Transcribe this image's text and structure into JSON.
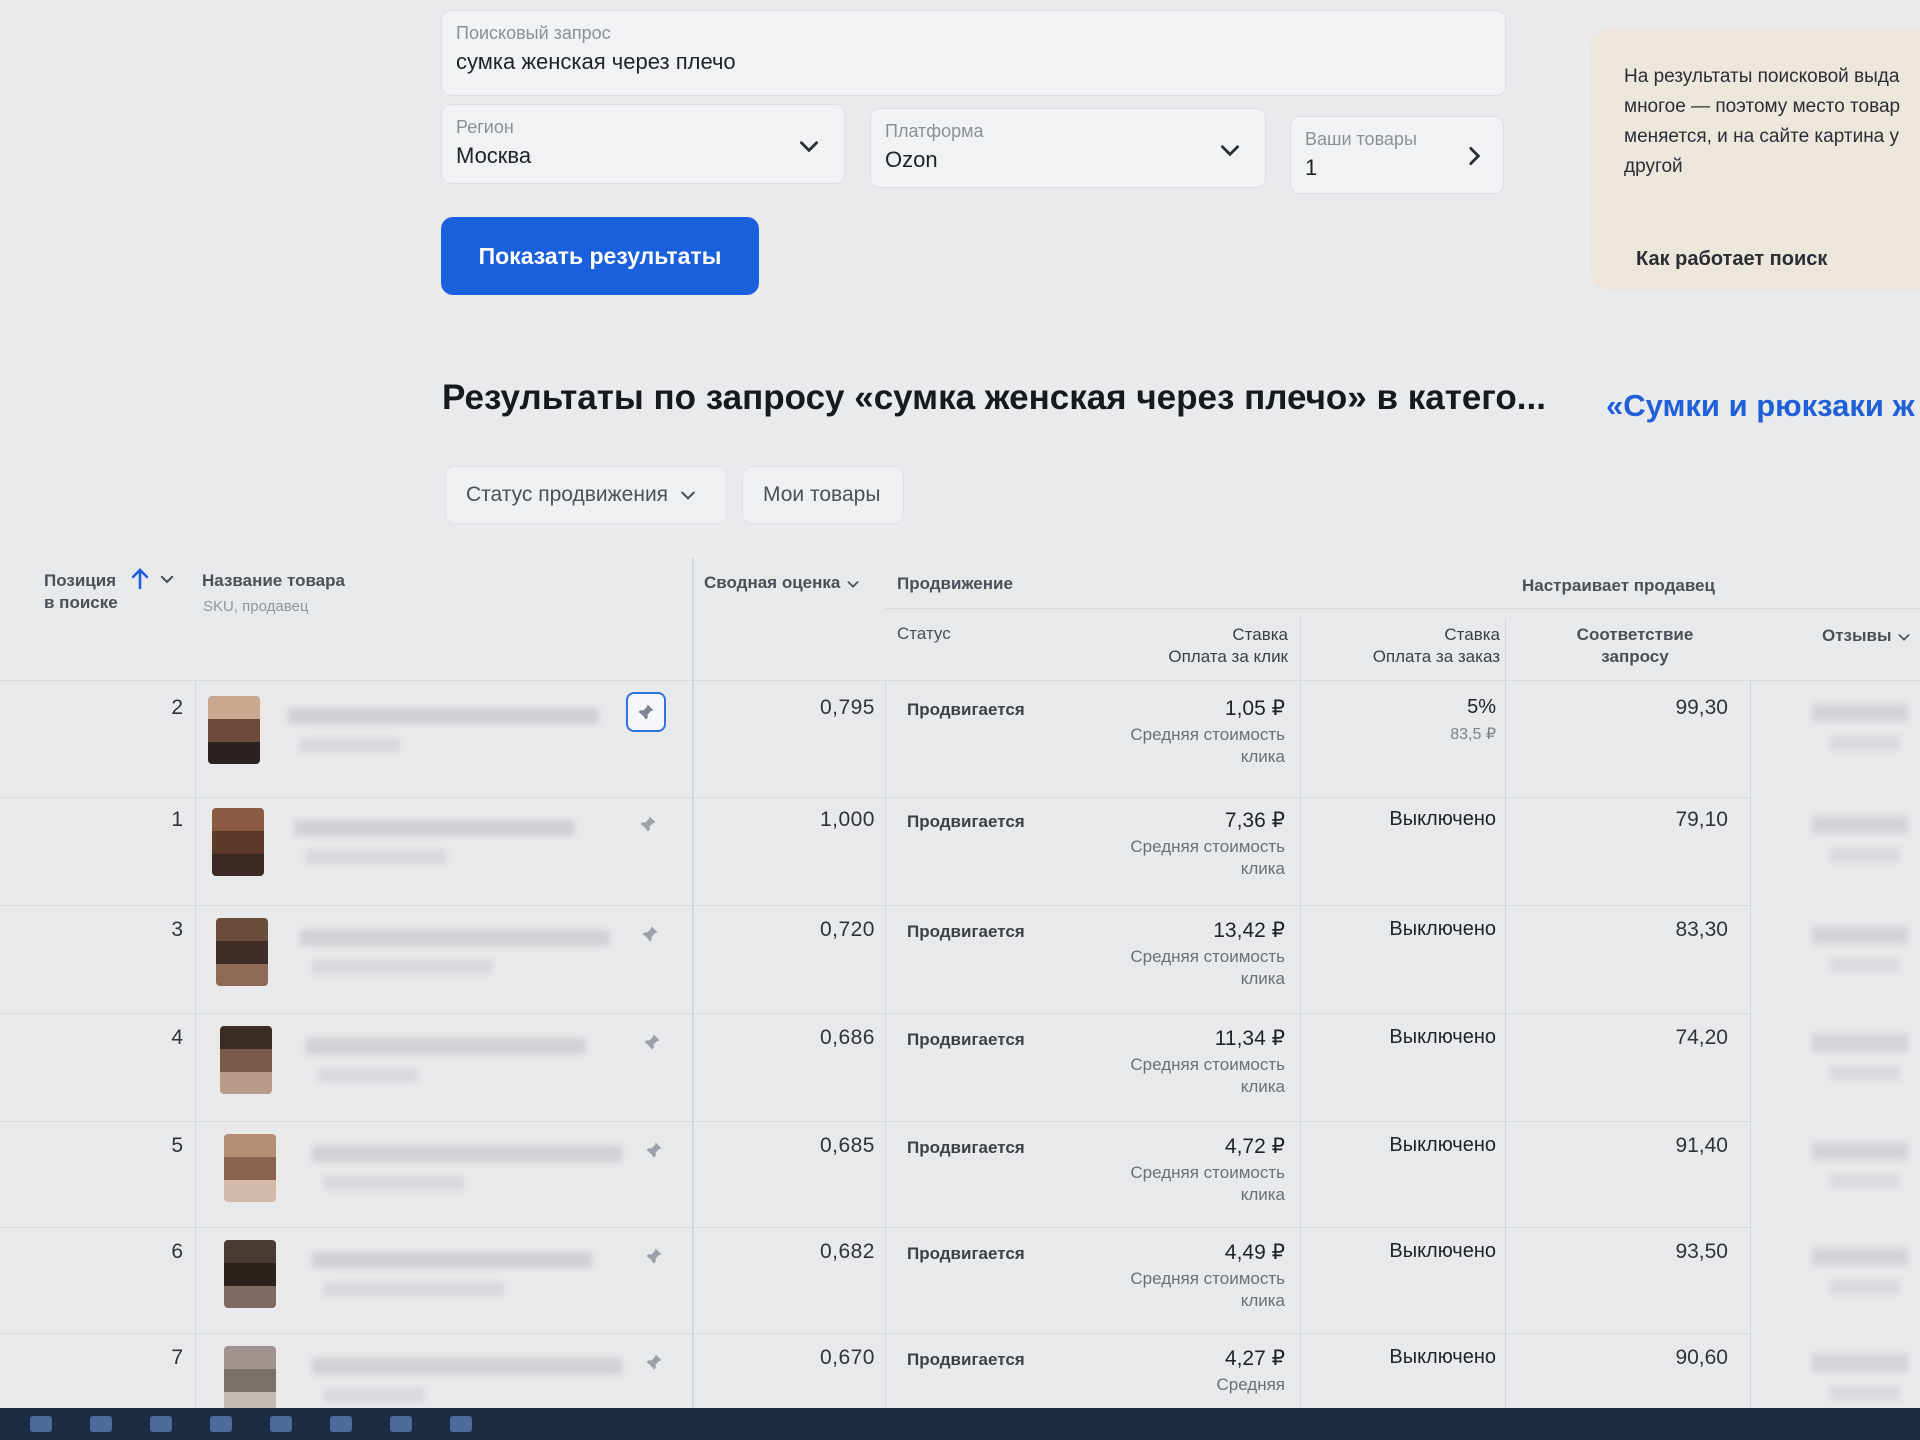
{
  "search": {
    "label": "Поисковый запрос",
    "value": "сумка женская через плечо"
  },
  "region": {
    "label": "Регион",
    "value": "Москва"
  },
  "platform": {
    "label": "Платформа",
    "value": "Ozon"
  },
  "your_items": {
    "label": "Ваши товары",
    "value": "1"
  },
  "show_button": "Показать результаты",
  "info": {
    "text": "На результаты поисковой выда многое — поэтому место товар меняется, и на сайте картина у другой",
    "link": "Как работает поиск"
  },
  "results": {
    "title": "Результаты по запросу «сумка женская через плечо» в катего...",
    "category_link": "«Сумки и рюкзаки ж"
  },
  "filters": {
    "status": "Статус продвижения",
    "my_items": "Мои товары"
  },
  "columns": {
    "position_line1": "Позиция",
    "position_line2": "в поиске",
    "name": "Название товара",
    "name_sub": "SKU, продавец",
    "score": "Сводная оценка",
    "promotion": "Продвижение",
    "seller_configured": "Настраивает продавец",
    "status": "Статус",
    "bid_click_line1": "Ставка",
    "bid_click_line2": "Оплата за клик",
    "bid_order_line1": "Ставка",
    "bid_order_line2": "Оплата за заказ",
    "match_line1": "Соответствие",
    "match_line2": "запросу",
    "reviews": "Отзывы"
  },
  "rows": [
    {
      "position": "2",
      "score": "0,795",
      "status": "Продвигается",
      "bid_click": "1,05 ₽",
      "bid_click_note": "Средняя стоимость клика",
      "bid_order": "5%",
      "bid_order_sub": "83,5 ₽",
      "match": "99,30"
    },
    {
      "position": "1",
      "score": "1,000",
      "status": "Продвигается",
      "bid_click": "7,36 ₽",
      "bid_click_note": "Средняя стоимость клика",
      "bid_order": "Выключено",
      "bid_order_sub": "",
      "match": "79,10"
    },
    {
      "position": "3",
      "score": "0,720",
      "status": "Продвигается",
      "bid_click": "13,42 ₽",
      "bid_click_note": "Средняя стоимость клика",
      "bid_order": "Выключено",
      "bid_order_sub": "",
      "match": "83,30"
    },
    {
      "position": "4",
      "score": "0,686",
      "status": "Продвигается",
      "bid_click": "11,34 ₽",
      "bid_click_note": "Средняя стоимость клика",
      "bid_order": "Выключено",
      "bid_order_sub": "",
      "match": "74,20"
    },
    {
      "position": "5",
      "score": "0,685",
      "status": "Продвигается",
      "bid_click": "4,72 ₽",
      "bid_click_note": "Средняя стоимость клика",
      "bid_order": "Выключено",
      "bid_order_sub": "",
      "match": "91,40"
    },
    {
      "position": "6",
      "score": "0,682",
      "status": "Продвигается",
      "bid_click": "4,49 ₽",
      "bid_click_note": "Средняя стоимость клика",
      "bid_order": "Выключено",
      "bid_order_sub": "",
      "match": "93,50"
    },
    {
      "position": "7",
      "score": "0,670",
      "status": "Продвигается",
      "bid_click": "4,27 ₽",
      "bid_click_note": "Средняя",
      "bid_order": "Выключено",
      "bid_order_sub": "",
      "match": "90,60"
    }
  ],
  "colors": {
    "accent": "#1a5fdc",
    "link": "#1f5fd8",
    "info_bg": "#ece6dc"
  }
}
